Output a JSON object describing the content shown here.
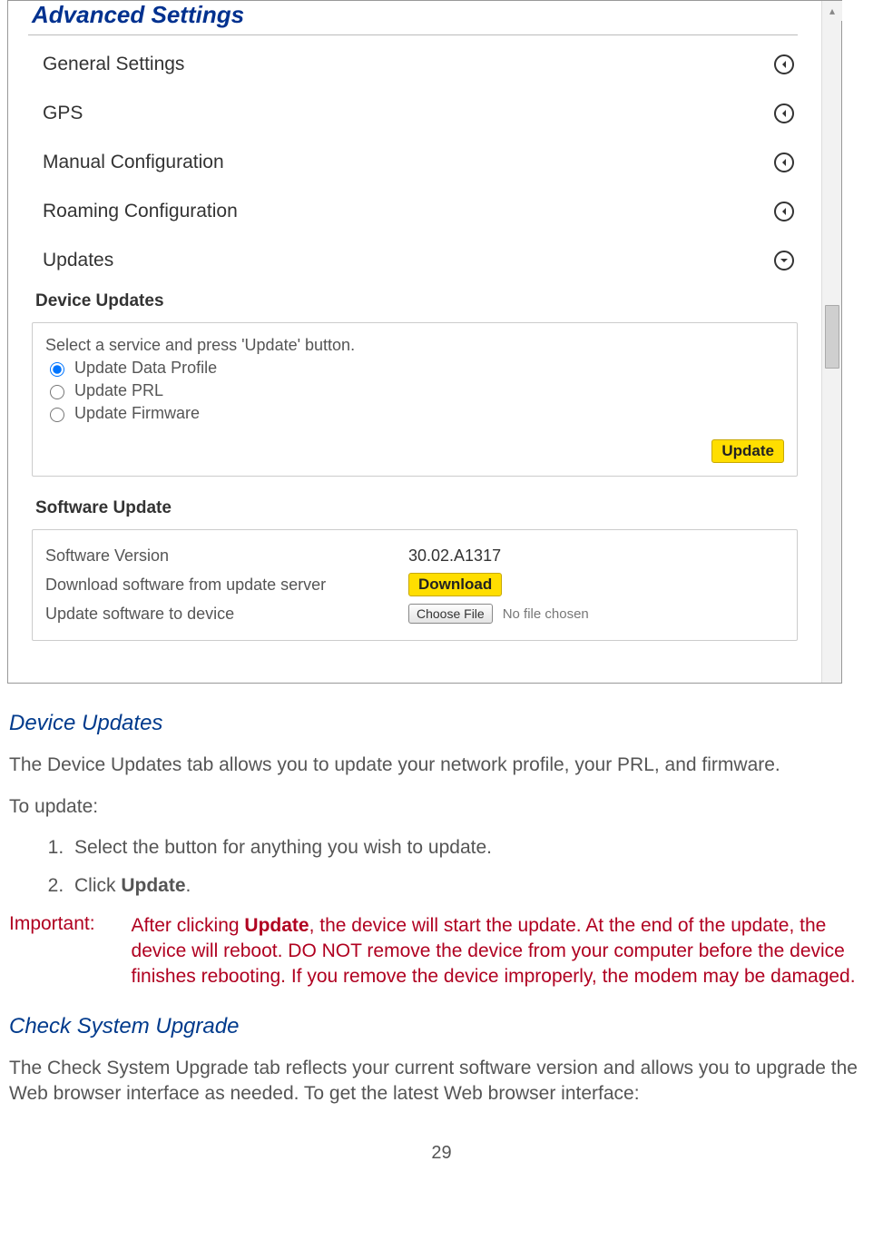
{
  "panel": {
    "header": "Advanced Settings",
    "items": [
      {
        "label": "General Settings",
        "expanded": false
      },
      {
        "label": "GPS",
        "expanded": false
      },
      {
        "label": "Manual Configuration",
        "expanded": false
      },
      {
        "label": "Roaming Configuration",
        "expanded": false
      },
      {
        "label": "Updates",
        "expanded": true
      }
    ],
    "device_updates": {
      "title": "Device Updates",
      "instruction": "Select a service and press 'Update' button.",
      "options": [
        {
          "label": "Update Data Profile",
          "checked": true
        },
        {
          "label": "Update PRL",
          "checked": false
        },
        {
          "label": "Update Firmware",
          "checked": false
        }
      ],
      "update_button": "Update"
    },
    "software_update": {
      "title": "Software Update",
      "version_label": "Software Version",
      "version_value": "30.02.A1317",
      "download_label": "Download software from update server",
      "download_button": "Download",
      "file_label": "Update software to device",
      "choose_file_button": "Choose File",
      "no_file_text": "No file chosen"
    }
  },
  "doc": {
    "h_device_updates": "Device Updates",
    "p_device_updates": "The Device Updates tab allows you to update your network profile, your PRL, and firmware.",
    "p_to_update": "To update:",
    "ol": [
      "Select the button for anything you wish to update.",
      "Click Update."
    ],
    "ol_bold_word": "Update",
    "important_label": "Important:",
    "important_pre": "After clicking ",
    "important_bold": "Update",
    "important_post": ", the device will start the update. At the end of the update, the device will reboot. DO NOT remove the device from your computer before the device finishes rebooting. If you remove the device improperly, the modem may be damaged.",
    "h_check_upgrade": "Check System Upgrade",
    "p_check_upgrade": "The Check System Upgrade tab reflects your current software version and allows you to upgrade the Web browser interface as needed.  To get the latest Web browser interface:",
    "page_number": "29"
  }
}
